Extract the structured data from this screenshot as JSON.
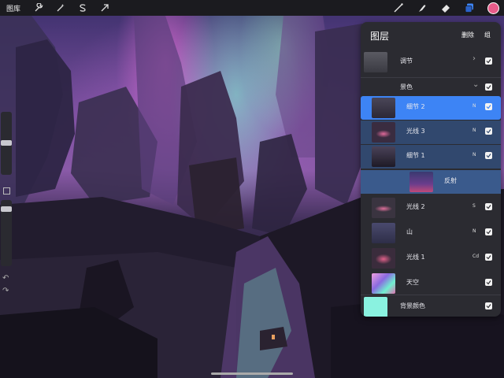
{
  "toolbar": {
    "gallery_label": "图库",
    "left_icons": [
      "wrench-icon",
      "magic-wand-icon",
      "selection-s-icon",
      "transform-arrow-icon"
    ],
    "right_icons": [
      "brush-icon",
      "smudge-icon",
      "eraser-icon",
      "layers-icon"
    ],
    "current_color": "#e85c8a"
  },
  "panel": {
    "title": "图层",
    "delete_label": "删除",
    "group_label": "组",
    "layers": [
      {
        "name": "调节",
        "kind": "group",
        "expanded": false,
        "visible": true
      },
      {
        "name": "景色",
        "kind": "group",
        "expanded": true,
        "visible": true
      },
      {
        "name": "细节 2",
        "kind": "layer",
        "mode": "N",
        "visible": true,
        "selected": true
      },
      {
        "name": "光线 3",
        "kind": "layer",
        "mode": "N",
        "visible": true
      },
      {
        "name": "细节 1",
        "kind": "layer",
        "mode": "N",
        "visible": true
      },
      {
        "name": "反射",
        "kind": "layer",
        "visible": true
      },
      {
        "name": "光线 2",
        "kind": "layer",
        "mode": "S",
        "visible": true
      },
      {
        "name": "山",
        "kind": "layer",
        "mode": "N",
        "visible": true
      },
      {
        "name": "光线 1",
        "kind": "layer",
        "mode": "Cd",
        "visible": true
      },
      {
        "name": "天空",
        "kind": "layer",
        "visible": true
      },
      {
        "name": "背景颜色",
        "kind": "background",
        "color": "#8af2e0",
        "visible": true
      }
    ]
  },
  "colors": {
    "selected_row": "#3d84f5",
    "group_child_row": "#31486e",
    "panel_bg": "#2b2b31"
  }
}
